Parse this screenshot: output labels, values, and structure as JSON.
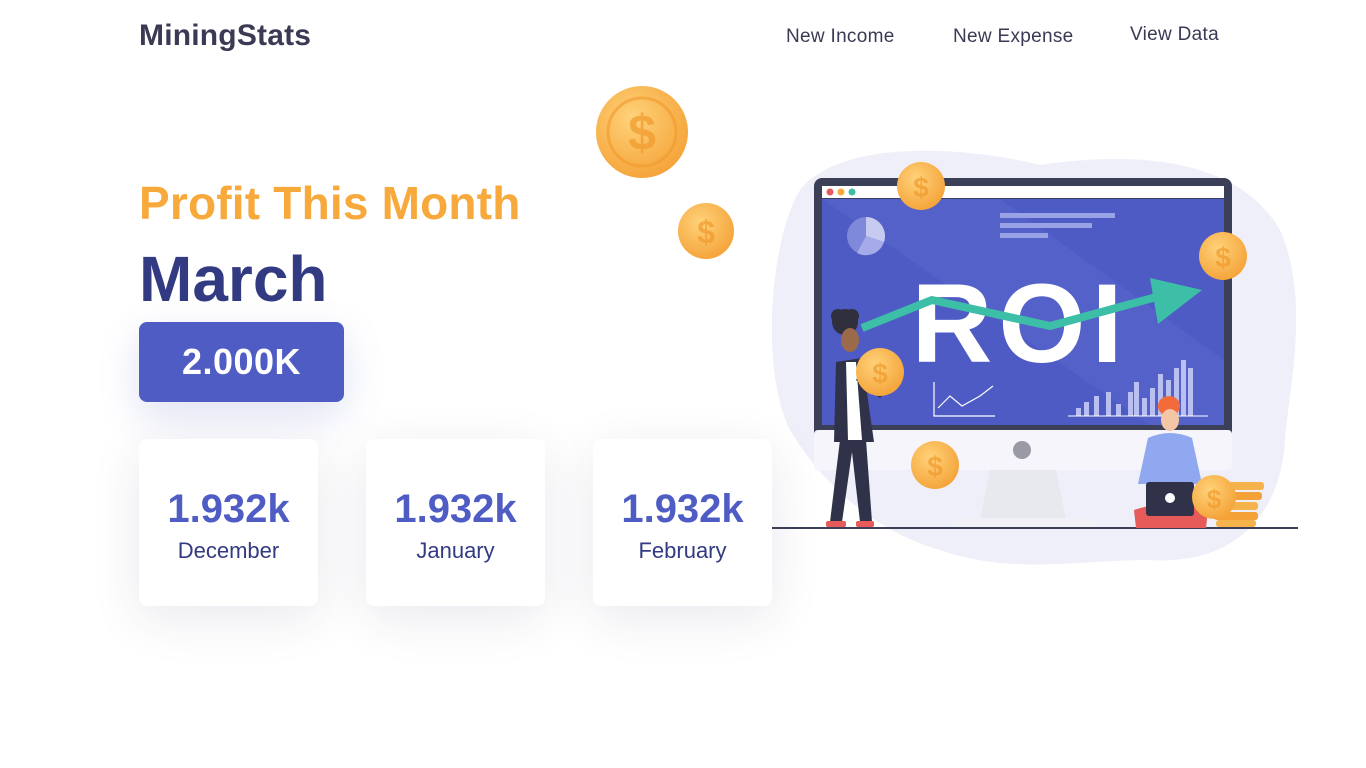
{
  "brand": {
    "name": "MiningStats"
  },
  "nav": {
    "new_income": "New Income",
    "new_expense": "New Expense",
    "view_data": "View Data"
  },
  "hero": {
    "kicker": "Profit This Month",
    "month": "March",
    "profit_value": "2.000K"
  },
  "history": [
    {
      "value": "1.932k",
      "month": "December"
    },
    {
      "value": "1.932k",
      "month": "January"
    },
    {
      "value": "1.932k",
      "month": "February"
    }
  ],
  "illustration": {
    "screen_text": "ROI",
    "icons": [
      "coin-icon",
      "pie-chart-icon",
      "line-chart-icon",
      "bar-chart-icon",
      "laptop-icon",
      "trend-arrow-icon"
    ]
  },
  "colors": {
    "accent_orange": "#f8a93c",
    "primary_blue": "#4f5cc4",
    "dark_navy": "#323a82",
    "teal": "#3dbfa7",
    "text_dark": "#3a3a55"
  }
}
